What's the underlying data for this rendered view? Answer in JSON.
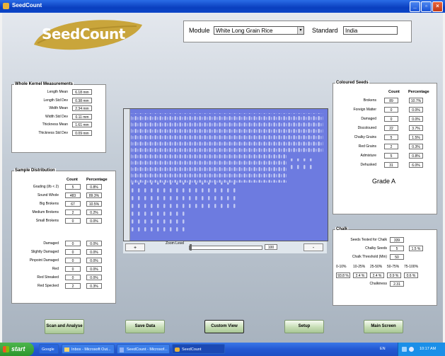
{
  "window": {
    "title": "SeedCount"
  },
  "logo": {
    "text": "SeedCount"
  },
  "module": {
    "label": "Module",
    "value": "White Long Grain Rice",
    "standard_label": "Standard",
    "standard_value": "India"
  },
  "whole_kernel": {
    "title": "Whole Kernel Measurements",
    "rows": [
      {
        "label": "Length Mean",
        "value": "6.18 mm"
      },
      {
        "label": "Length Std Dev",
        "value": "0.38 mm"
      },
      {
        "label": "Width Mean",
        "value": "2.34 mm"
      },
      {
        "label": "Width Std Dev",
        "value": "0.11 mm"
      },
      {
        "label": "Thickness Mean",
        "value": "1.61 mm"
      },
      {
        "label": "Thickness Std Dev",
        "value": "0.09 mm"
      }
    ]
  },
  "sample_distribution": {
    "title": "Sample Distribution",
    "col_count": "Count",
    "col_pct": "Percentage",
    "rows": [
      {
        "label": "Grading (l/b < 2)",
        "count": "5",
        "pct": "0.8%"
      },
      {
        "label": "Sound Whole",
        "count": "483",
        "pct": "89.3%"
      },
      {
        "label": "Big Brokens",
        "count": "67",
        "pct": "10.5%"
      },
      {
        "label": "Medium Brokens",
        "count": "2",
        "pct": "0.2%"
      },
      {
        "label": "Small Brokens",
        "count": "0",
        "pct": "0.0%"
      },
      {
        "label": "Damaged",
        "count": "0",
        "pct": "0.0%"
      },
      {
        "label": "Slightly Damaged",
        "count": "0",
        "pct": "0.0%"
      },
      {
        "label": "Pinpoint Damaged",
        "count": "0",
        "pct": "0.0%"
      },
      {
        "label": "Red",
        "count": "0",
        "pct": "0.0%"
      },
      {
        "label": "Red Streaked",
        "count": "0",
        "pct": "0.0%"
      },
      {
        "label": "Red Specked",
        "count": "2",
        "pct": "0.3%"
      }
    ]
  },
  "coloured_seeds": {
    "title": "Coloured Seeds",
    "col_count": "Count",
    "col_pct": "Percentage",
    "rows": [
      {
        "label": "Brokens",
        "count": "89",
        "pct": "10.7%"
      },
      {
        "label": "Foreign Matter",
        "count": "0",
        "pct": "0.0%"
      },
      {
        "label": "Damaged",
        "count": "0",
        "pct": "0.0%"
      },
      {
        "label": "Discoloured",
        "count": "22",
        "pct": "3.7%"
      },
      {
        "label": "Chalky Grains",
        "count": "5",
        "pct": "1.5%"
      },
      {
        "label": "Red Grains",
        "count": "2",
        "pct": "0.3%"
      },
      {
        "label": "Admixture",
        "count": "5",
        "pct": "0.8%"
      },
      {
        "label": "Dehusked",
        "count": "31",
        "pct": "6.0%"
      }
    ],
    "grade": "Grade A"
  },
  "chalk": {
    "title": "Chalk",
    "tested_label": "Seeds Tested for Chalk",
    "tested": "339",
    "chalky_label": "Chalky Seeds",
    "chalky": "5",
    "chalky_pct": "1.5 %",
    "threshold_label": "Chalk Threshold (Min)",
    "threshold": "50",
    "ranges": [
      "0-10%",
      "10-25%",
      "25-50%",
      "50-75%",
      "75-100%"
    ],
    "range_values": [
      "93.8 %",
      "2.4 %",
      "2.4 %",
      "0.9 %",
      "0.6 %"
    ],
    "chalkiness_label": "Chalkiness",
    "chalkiness": "2.31"
  },
  "zoom": {
    "label": "Zoom Level",
    "value": "100",
    "minus": "-",
    "plus": "+"
  },
  "buttons": {
    "scan": "Scan and Analyse",
    "save": "Save Data",
    "custom": "Custom View",
    "setup": "Setup",
    "main": "Main Screen"
  },
  "taskbar": {
    "start": "start",
    "items": [
      "Google",
      "Inbox - Microsoft Out...",
      "SeedCount - Microsof...",
      "SeedCount"
    ],
    "lang": "EN",
    "time": "10:17 AM"
  },
  "colors": {
    "image_bg": "#6d7be0",
    "button": "#c6ddb5",
    "titlebar": "#0a3fbf"
  }
}
